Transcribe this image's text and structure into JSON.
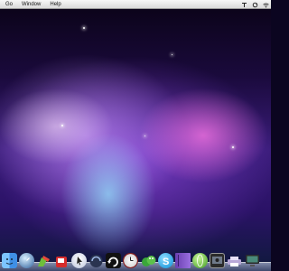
{
  "menubar": {
    "items": [
      "Go",
      "Window",
      "Help"
    ],
    "right_icons": [
      "menu-extra-icon",
      "sync-icon",
      "wifi-icon"
    ]
  },
  "dock": {
    "icons": [
      "finder-icon",
      "dashboard-icon",
      "pen-tool-icon",
      "red-app-icon",
      "cursor-app-icon",
      "dark-circle-app-icon",
      "arrow-app-icon",
      "clock-app-icon",
      "frogs-app-icon",
      "skype-icon",
      "notebook-icon",
      "globe-app-icon",
      "photo-booth-icon",
      "printer-icon",
      "monitor-icon"
    ]
  }
}
